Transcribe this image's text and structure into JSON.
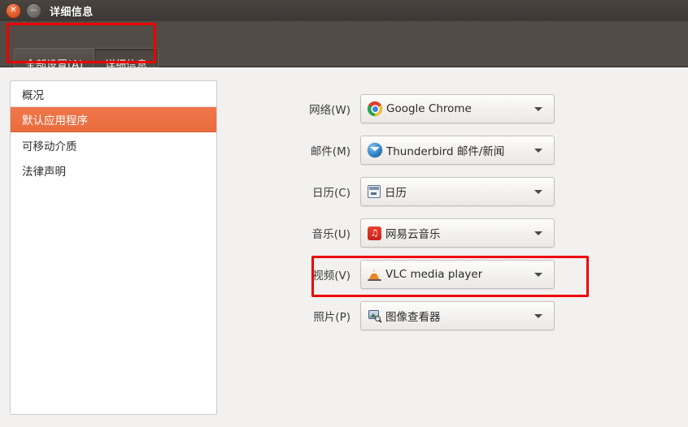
{
  "window": {
    "title": "详细信息",
    "close_icon": "close-icon",
    "close_glyph": "✕",
    "minimize_icon": "minimize-icon",
    "minimize_glyph": "—"
  },
  "toolbar": {
    "tabs": [
      {
        "label": "全部设置(A)",
        "active": false
      },
      {
        "label": "详细信息",
        "active": true
      }
    ]
  },
  "sidebar": {
    "items": [
      {
        "label": "概况",
        "selected": false
      },
      {
        "label": "默认应用程序",
        "selected": true
      },
      {
        "label": "可移动介质",
        "selected": false
      },
      {
        "label": "法律声明",
        "selected": false
      }
    ]
  },
  "defaults_form": {
    "rows": [
      {
        "label": "网络(W)",
        "value": "Google Chrome",
        "icon": "chrome-icon"
      },
      {
        "label": "邮件(M)",
        "value": "Thunderbird 邮件/新闻",
        "icon": "thunderbird-icon"
      },
      {
        "label": "日历(C)",
        "value": "日历",
        "icon": "calendar-icon"
      },
      {
        "label": "音乐(U)",
        "value": "网易云音乐",
        "icon": "netease-music-icon"
      },
      {
        "label": "视频(V)",
        "value": "VLC media player",
        "icon": "vlc-icon"
      },
      {
        "label": "照片(P)",
        "value": "图像查看器",
        "icon": "image-viewer-icon"
      }
    ],
    "dropdown_arrow_icon": "chevron-down-icon"
  },
  "annotations": [
    {
      "name": "highlight-tabs",
      "color": "#ee0000"
    },
    {
      "name": "highlight-video-row",
      "color": "#ee0000"
    }
  ],
  "colors": {
    "titlebar": "#3c3835",
    "toolbar": "#534b46",
    "background": "#f2f1f0",
    "selection": "#e96c3e",
    "annotation": "#ee0000"
  }
}
